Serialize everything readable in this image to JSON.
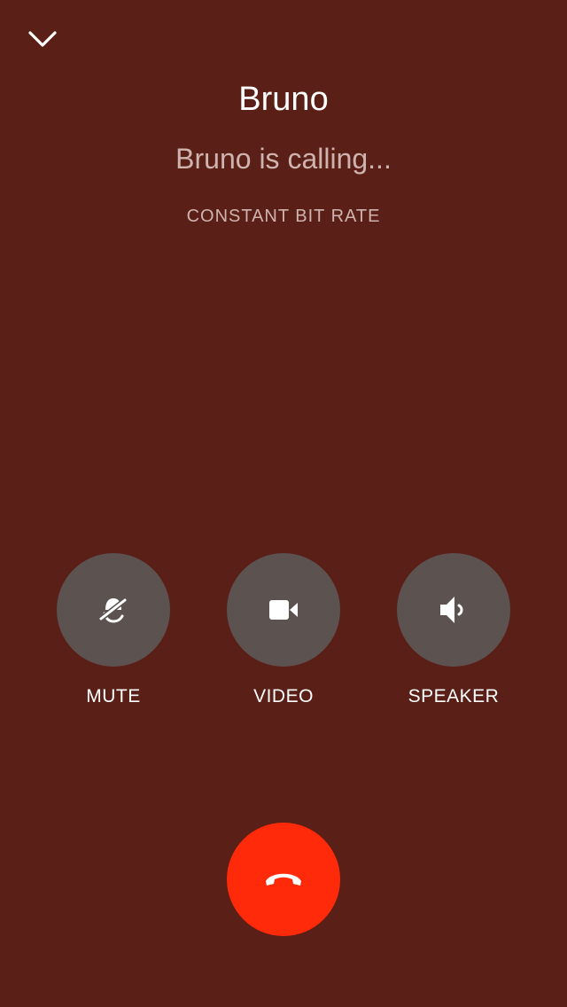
{
  "caller": {
    "name": "Bruno",
    "status": "Bruno is calling...",
    "codec": "CONSTANT BIT RATE"
  },
  "controls": [
    {
      "label": "MUTE",
      "icon": "microphone-off-icon"
    },
    {
      "label": "VIDEO",
      "icon": "video-camera-icon"
    },
    {
      "label": "SPEAKER",
      "icon": "speaker-icon"
    }
  ],
  "icons": {
    "collapse": "chevron-down-icon",
    "hangup": "phone-hangup-icon"
  },
  "colors": {
    "background": "#5a1f17",
    "control_button": "#5c5250",
    "hangup_button": "#ff2a0a",
    "secondary_text": "#cfb3ae"
  }
}
